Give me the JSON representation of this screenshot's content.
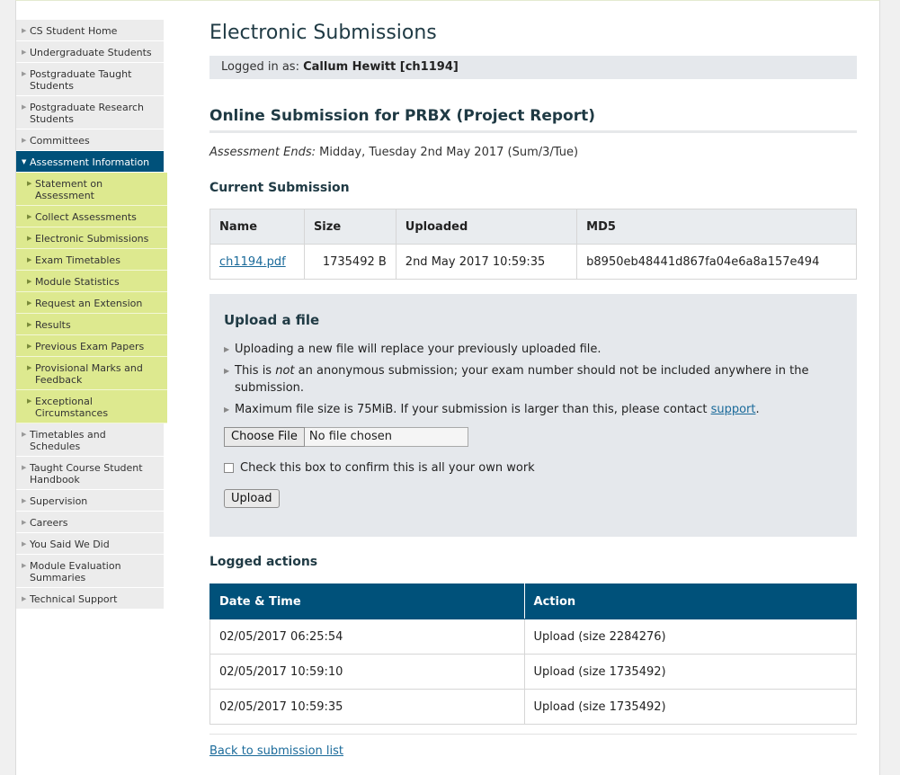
{
  "sidebar": {
    "items": [
      {
        "label": "CS Student Home"
      },
      {
        "label": "Undergraduate Students"
      },
      {
        "label": "Postgraduate Taught Students"
      },
      {
        "label": "Postgraduate Research Students"
      },
      {
        "label": "Committees"
      },
      {
        "label": "Assessment Information"
      },
      {
        "label": "Timetables and Schedules"
      },
      {
        "label": "Taught Course Student Handbook"
      },
      {
        "label": "Supervision"
      },
      {
        "label": "Careers"
      },
      {
        "label": "You Said We Did"
      },
      {
        "label": "Module Evaluation Summaries"
      },
      {
        "label": "Technical Support"
      }
    ],
    "subitems": [
      {
        "label": "Statement on Assessment"
      },
      {
        "label": "Collect Assessments"
      },
      {
        "label": "Electronic Submissions"
      },
      {
        "label": "Exam Timetables"
      },
      {
        "label": "Module Statistics"
      },
      {
        "label": "Request an Extension"
      },
      {
        "label": "Results"
      },
      {
        "label": "Previous Exam Papers"
      },
      {
        "label": "Provisional Marks and Feedback"
      },
      {
        "label": "Exceptional Circumstances"
      }
    ]
  },
  "header": {
    "title": "Electronic Submissions",
    "logged_in_label": "Logged in as:",
    "logged_in_user": "Callum Hewitt [ch1194]"
  },
  "submission": {
    "title": "Online Submission for PRBX (Project Report)",
    "ends_label": "Assessment Ends:",
    "ends_value": "Midday, Tuesday 2nd May 2017 (Sum/3/Tue)"
  },
  "current": {
    "title": "Current Submission",
    "columns": [
      "Name",
      "Size",
      "Uploaded",
      "MD5"
    ],
    "row": {
      "name": "ch1194.pdf",
      "size": "1735492 B",
      "uploaded": "2nd May 2017 10:59:35",
      "md5": "b8950eb48441d867fa04e6a8a157e494"
    }
  },
  "upload": {
    "title": "Upload a file",
    "bullet1": "Uploading a new file will replace your previously uploaded file.",
    "bullet2_pre": "This is ",
    "bullet2_em": "not",
    "bullet2_post": " an anonymous submission; your exam number should not be included anywhere in the submission.",
    "bullet3_pre": "Maximum file size is 75MiB. If your submission is larger than this, please contact ",
    "bullet3_link": "support",
    "bullet3_post": ".",
    "choose_label": "Choose File",
    "no_file": "No file chosen",
    "confirm_label": "Check this box to confirm this is all your own work",
    "upload_label": "Upload"
  },
  "logged": {
    "title": "Logged actions",
    "columns": [
      "Date & Time",
      "Action"
    ],
    "rows": [
      {
        "time": "02/05/2017 06:25:54",
        "action": "Upload (size 2284276)"
      },
      {
        "time": "02/05/2017 10:59:10",
        "action": "Upload (size 1735492)"
      },
      {
        "time": "02/05/2017 10:59:35",
        "action": "Upload (size 1735492)"
      }
    ]
  },
  "footer": {
    "back_link": "Back to submission list"
  }
}
